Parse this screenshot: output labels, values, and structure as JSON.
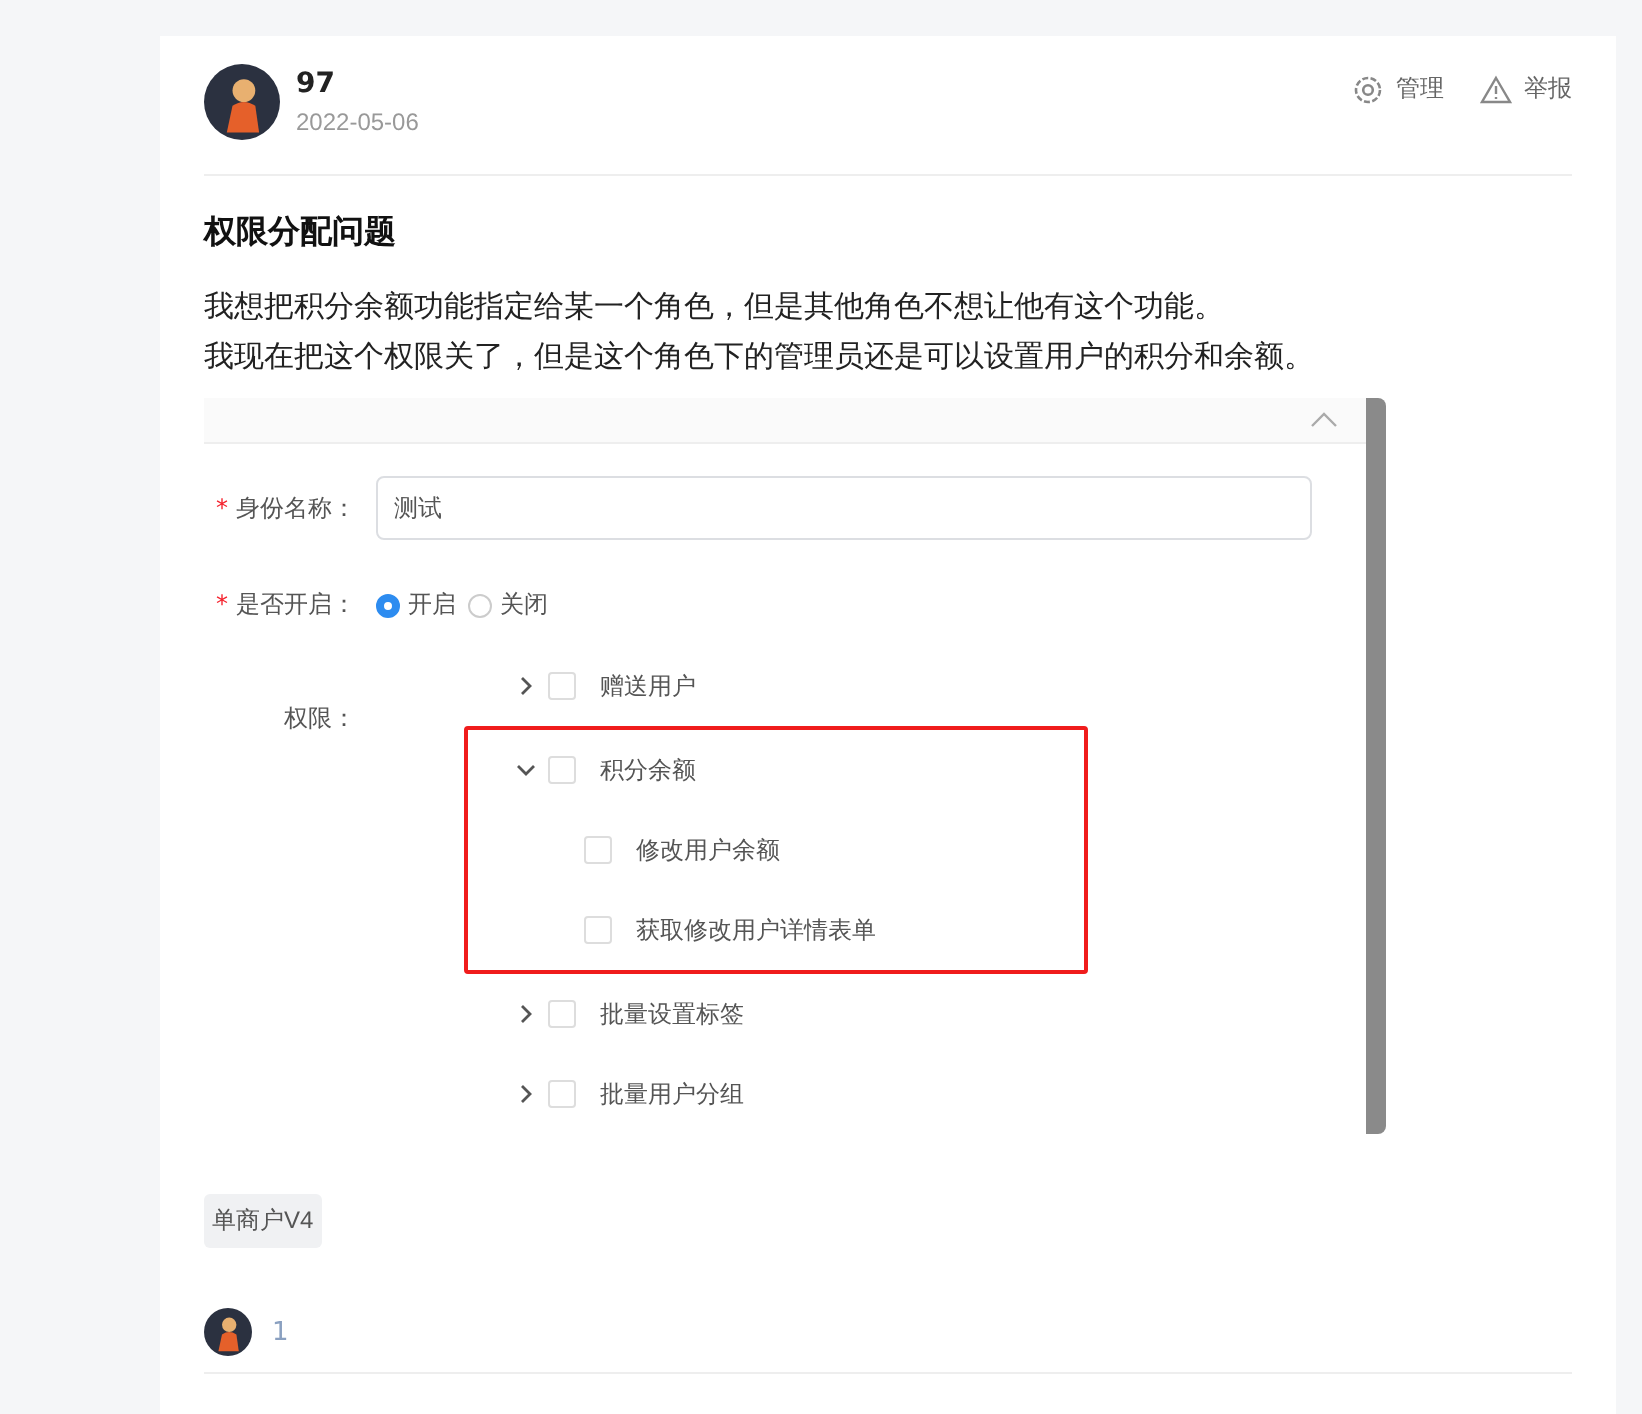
{
  "post": {
    "author": "97",
    "date": "2022-05-06",
    "actions": [
      {
        "kind": "manage",
        "label": "管理"
      },
      {
        "kind": "report",
        "label": "举报"
      }
    ],
    "title": "权限分配问题",
    "body": [
      "我想把积分余额功能指定给某一个角色，但是其他角色不想让他有这个功能。",
      "我现在把这个权限关了，但是这个角色下的管理员还是可以设置用户的积分和余额。"
    ],
    "screenshot": {
      "form": {
        "required_mark": "*",
        "name_label": "身份名称：",
        "name_value": "测试",
        "enabled_label": "是否开启：",
        "radios": [
          {
            "label": "开启",
            "selected": true
          },
          {
            "label": "关闭",
            "selected": false
          }
        ],
        "permissions_label": "权限：",
        "tree": [
          {
            "label": "赠送用户",
            "expanded": false,
            "checked": false,
            "highlighted": false
          },
          {
            "label": "积分余额",
            "expanded": true,
            "checked": false,
            "highlighted": true,
            "children": [
              {
                "label": "修改用户余额",
                "checked": false
              },
              {
                "label": "获取修改用户详情表单",
                "checked": false
              }
            ]
          },
          {
            "label": "批量设置标签",
            "expanded": false,
            "checked": false,
            "highlighted": false
          },
          {
            "label": "批量用户分组",
            "expanded": false,
            "checked": false,
            "highlighted": false
          }
        ]
      }
    },
    "tags": [
      "单商户V4"
    ],
    "reply_count": "1"
  }
}
